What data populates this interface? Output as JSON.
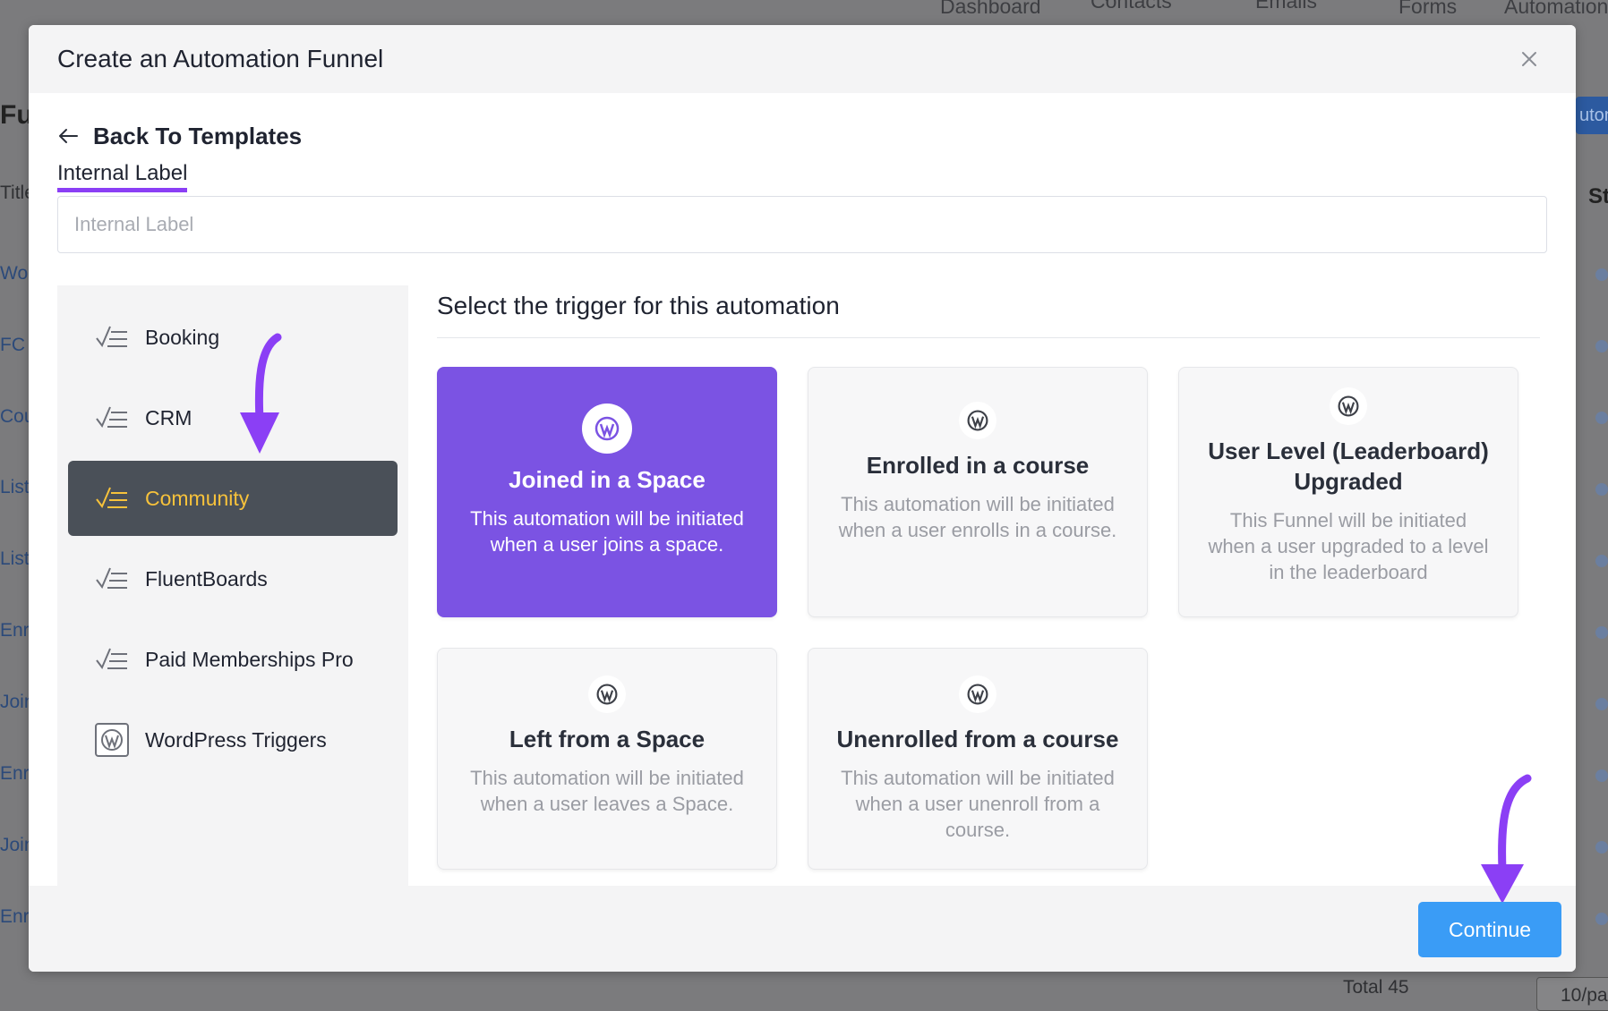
{
  "background": {
    "nav": [
      "Dashboard",
      "Contacts",
      "Emails",
      "Forms",
      "Automation"
    ],
    "left_fragments": [
      "Fu",
      "Title",
      "Wor",
      "FC I",
      "Cou",
      "List",
      "List",
      "Enr",
      "Join",
      "Enr",
      "Join",
      "Enr"
    ],
    "right_button": "utom",
    "right_header": "St",
    "footer_total": "Total 45",
    "pager": "10/pa"
  },
  "modal": {
    "title": "Create an Automation Funnel",
    "back_label": "Back To Templates",
    "internal_label_title": "Internal Label",
    "internal_label_placeholder": "Internal Label",
    "internal_label_value": "",
    "trigger_heading": "Select the trigger for this automation",
    "continue_label": "Continue"
  },
  "sidebar": {
    "items": [
      {
        "label": "Booking",
        "icon": "checklist-icon",
        "active": false
      },
      {
        "label": "CRM",
        "icon": "checklist-icon",
        "active": false
      },
      {
        "label": "Community",
        "icon": "checklist-icon",
        "active": true
      },
      {
        "label": "FluentBoards",
        "icon": "checklist-icon",
        "active": false
      },
      {
        "label": "Paid Memberships Pro",
        "icon": "checklist-icon",
        "active": false
      },
      {
        "label": "WordPress Triggers",
        "icon": "wordpress-icon",
        "active": false
      }
    ]
  },
  "triggers": [
    {
      "title": "Joined in a Space",
      "description": "This automation will be initiated when a user joins a space.",
      "selected": true
    },
    {
      "title": "Enrolled in a course",
      "description": "This automation will be initiated when a user enrolls in a course.",
      "selected": false
    },
    {
      "title": "User Level (Leaderboard) Upgraded",
      "description": "This Funnel will be initiated when a user upgraded to a level in the leaderboard",
      "selected": false
    },
    {
      "title": "Left from a Space",
      "description": "This automation will be initiated when a user leaves a Space.",
      "selected": false
    },
    {
      "title": "Unenrolled from a course",
      "description": "This automation will be initiated when a user unenroll from a course.",
      "selected": false
    }
  ],
  "colors": {
    "accent_purple": "#7b53e3",
    "annotation_purple": "#8b3ff5",
    "continue_blue": "#3a9cf6",
    "active_sidebar_bg": "#4a5058",
    "active_sidebar_text": "#f7c23b"
  }
}
